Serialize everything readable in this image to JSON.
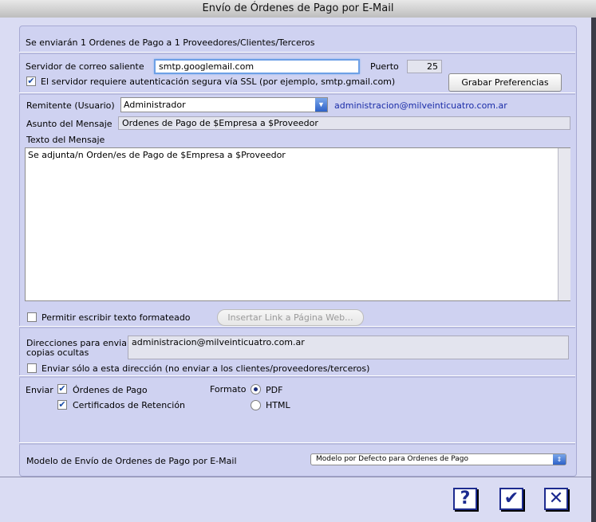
{
  "window": {
    "title": "Envío de Órdenes de Pago por E-Mail"
  },
  "summary": "Se enviarán 1 Ordenes de Pago a 1 Proveedores/Clientes/Terceros",
  "smtp": {
    "server_label": "Servidor de correo saliente",
    "server_value": "smtp.googlemail.com",
    "port_label": "Puerto",
    "port_value": "25",
    "ssl_label": "El servidor requiere autenticación segura vía SSL (por ejemplo, smtp.gmail.com)",
    "ssl_checked": true,
    "save_prefs_label": "Grabar Preferencias"
  },
  "sender": {
    "label": "Remitente (Usuario)",
    "selected": "Administrador",
    "email": "administracion@milveinticuatro.com.ar"
  },
  "subject": {
    "label": "Asunto del Mensaje",
    "value": "Ordenes de Pago de $Empresa a $Proveedor"
  },
  "message": {
    "label": "Texto del Mensaje",
    "value": "Se adjunta/n Orden/es de Pago de $Empresa a $Proveedor"
  },
  "formatting": {
    "allow_formatted_label": "Permitir escribir texto formateado",
    "allow_formatted_checked": false,
    "insert_link_label": "Insertar Link a Página Web..."
  },
  "bcc": {
    "label_line1": "Direcciones para enviar",
    "label_line2": "copias ocultas",
    "value": "administracion@milveinticuatro.com.ar",
    "only_this_label": "Enviar sólo a esta dirección (no enviar a los clientes/proveedores/terceros)",
    "only_this_checked": false
  },
  "send": {
    "label": "Enviar",
    "orders_label": "Órdenes de Pago",
    "orders_checked": true,
    "certs_label": "Certificados de Retención",
    "certs_checked": true,
    "format_label": "Formato",
    "pdf_label": "PDF",
    "html_label": "HTML",
    "selected_format": "PDF"
  },
  "model": {
    "label": "Modelo de Envío de Ordenes de Pago por E-Mail",
    "selected": "Modelo por Defecto para Ordenes de Pago"
  },
  "icons": {
    "help": "help-icon",
    "ok": "checkmark-icon",
    "cancel": "close-icon"
  },
  "colors": {
    "window_bg": "#dadcf3",
    "panel_bg": "#cfd2f1",
    "accent": "#1b2a8f",
    "link": "#1a2ca8"
  }
}
